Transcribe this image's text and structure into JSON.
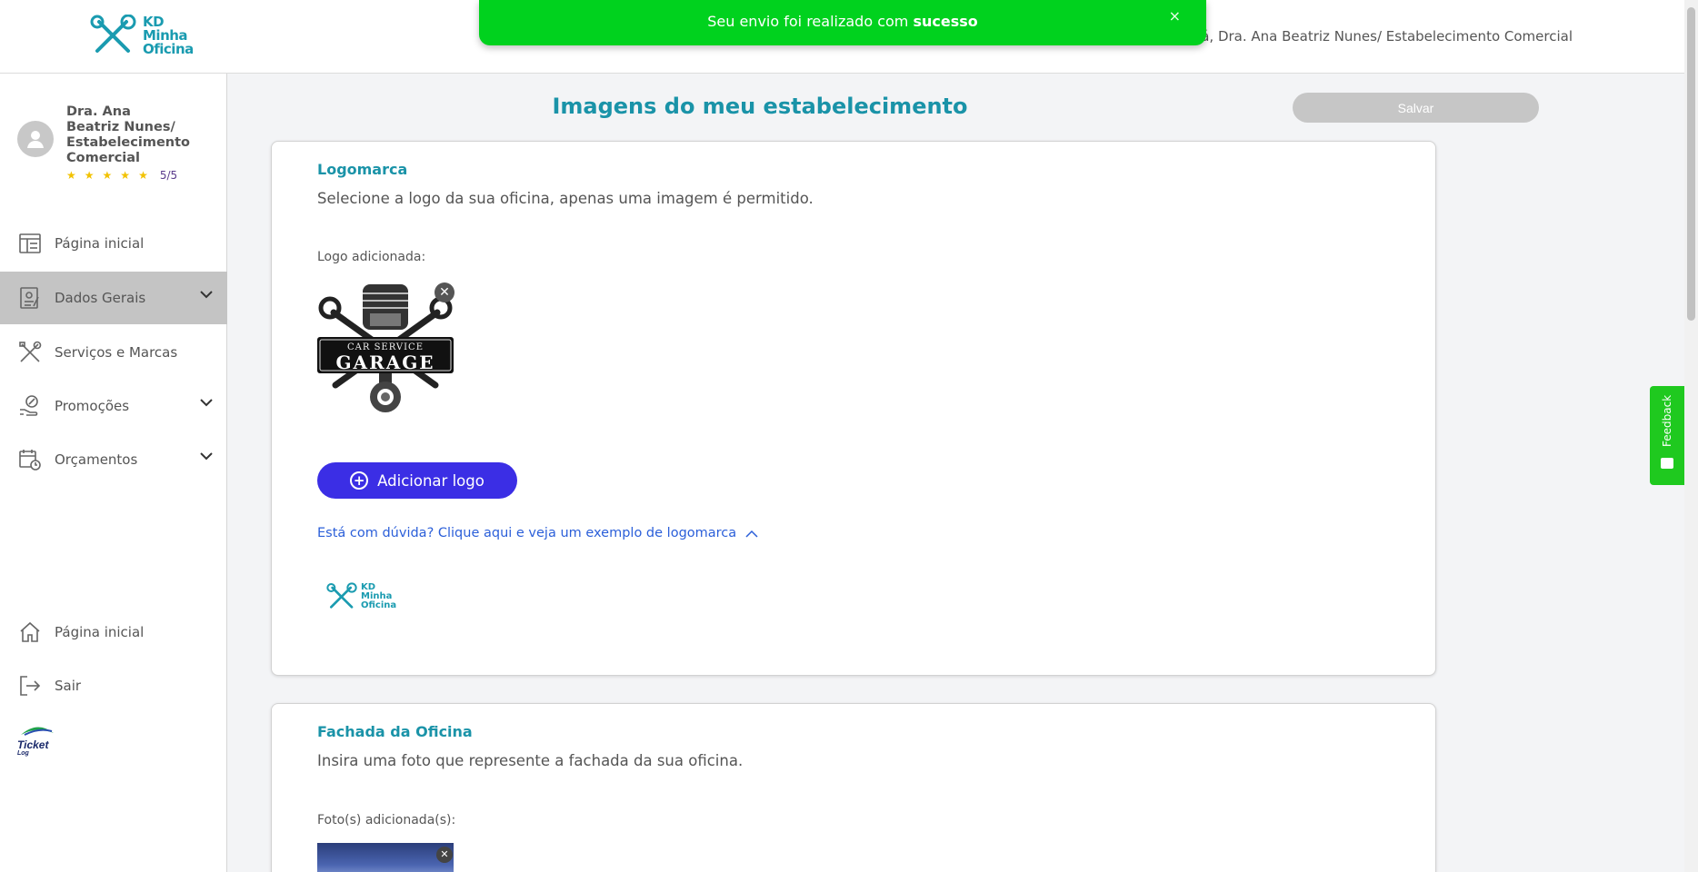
{
  "brand": {
    "line1": "KD",
    "line2": "Minha",
    "line3": "Oficina"
  },
  "header": {
    "greeting": "Olá, Dra. Ana Beatriz Nunes/ Estabelecimento Comercial"
  },
  "toast": {
    "prefix": "Seu envio foi realizado com ",
    "bold": "sucesso",
    "close": "×"
  },
  "sidebar": {
    "profile": {
      "name": "Dra. Ana Beatriz Nunes/ Estabelecimento Comercial",
      "rating": "5/5",
      "stars": 5
    },
    "items": [
      {
        "label": "Página inicial",
        "icon": "layout-icon"
      },
      {
        "label": "Dados Gerais",
        "icon": "document-edit-icon",
        "active": true
      },
      {
        "label": "Serviços e Marcas",
        "icon": "tools-icon"
      },
      {
        "label": "Promoções",
        "icon": "discount-hand-icon"
      },
      {
        "label": "Orçamentos",
        "icon": "calendar-clock-icon"
      }
    ],
    "bottom": [
      {
        "label": "Página inicial",
        "icon": "home-icon"
      },
      {
        "label": "Sair",
        "icon": "logout-icon"
      }
    ],
    "partner_logo": {
      "line1": "Ticket",
      "line2": "Log"
    }
  },
  "main": {
    "title": "Imagens do meu estabelecimento",
    "save_label": "Salvar",
    "logo_card": {
      "title": "Logomarca",
      "description": "Selecione a logo da sua oficina, apenas uma imagem é permitido.",
      "added_label": "Logo adicionada:",
      "logo_text_top": "CAR SERVICE",
      "logo_text_main": "GARAGE",
      "add_button": "Adicionar logo",
      "help_link": "Está com dúvida? Clique aqui e veja um exemplo de logomarca"
    },
    "facade_card": {
      "title": "Fachada da Oficina",
      "description": "Insira uma foto que represente a fachada da sua oficina.",
      "added_label": "Foto(s) adicionada(s):"
    }
  },
  "feedback": {
    "label": "Feedback"
  },
  "colors": {
    "accent": "#1a93a8",
    "primary_button": "#3b2ee5",
    "toast": "#00d21e",
    "link": "#2b5fd9"
  }
}
